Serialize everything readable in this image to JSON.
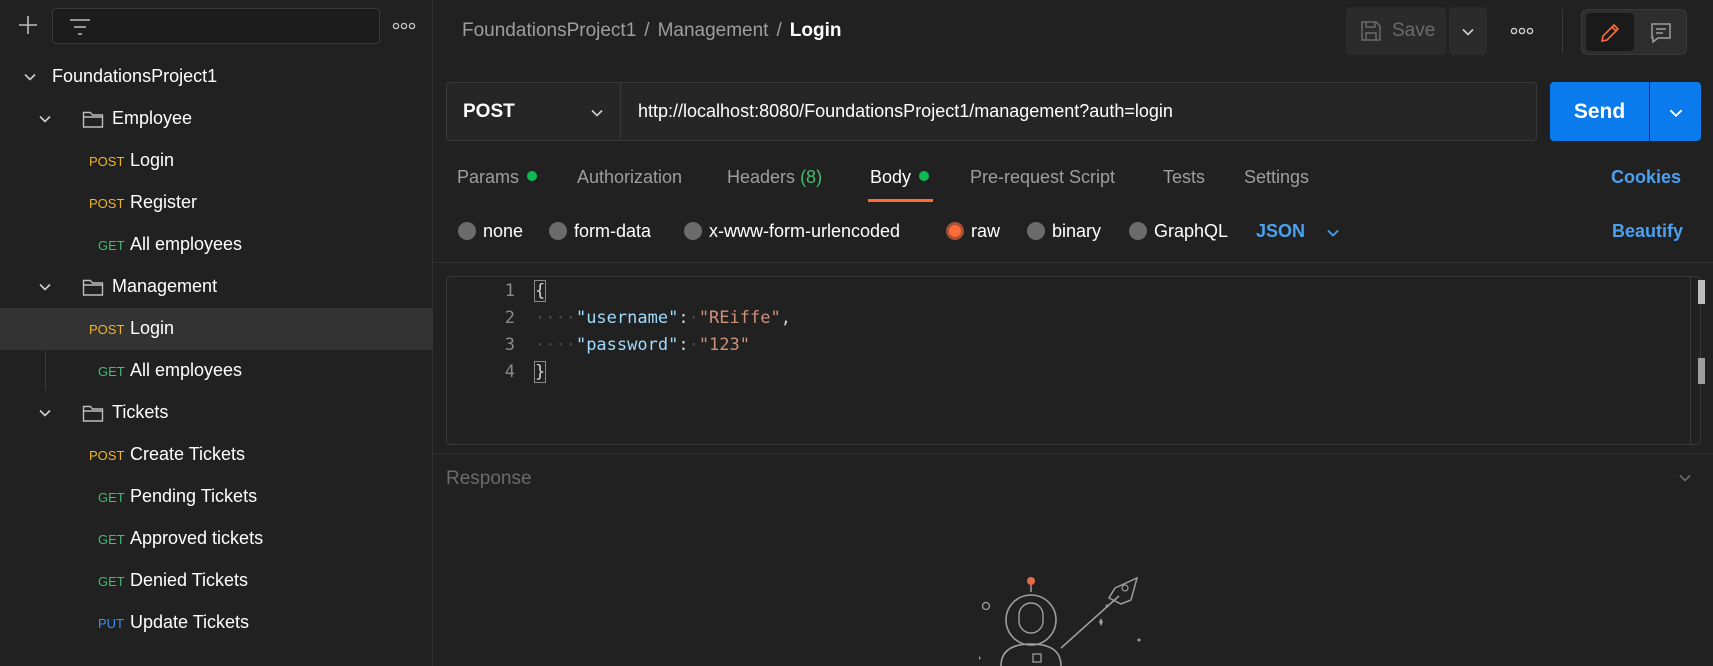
{
  "sidebar": {
    "tree": [
      {
        "kind": "collection",
        "label": "FoundationsProject1"
      },
      {
        "kind": "folder",
        "label": "Employee"
      },
      {
        "kind": "request",
        "method": "POST",
        "label": "Login"
      },
      {
        "kind": "request",
        "method": "POST",
        "label": "Register"
      },
      {
        "kind": "request",
        "method": "GET",
        "label": "All employees"
      },
      {
        "kind": "folder",
        "label": "Management"
      },
      {
        "kind": "request",
        "method": "POST",
        "label": "Login",
        "selected": true
      },
      {
        "kind": "request",
        "method": "GET",
        "label": "All employees"
      },
      {
        "kind": "folder",
        "label": "Tickets"
      },
      {
        "kind": "request",
        "method": "POST",
        "label": "Create Tickets"
      },
      {
        "kind": "request",
        "method": "GET",
        "label": "Pending Tickets"
      },
      {
        "kind": "request",
        "method": "GET",
        "label": "Approved tickets"
      },
      {
        "kind": "request",
        "method": "GET",
        "label": "Denied Tickets"
      },
      {
        "kind": "request",
        "method": "PUT",
        "label": "Update Tickets"
      }
    ]
  },
  "header": {
    "breadcrumb": [
      "FoundationsProject1",
      "Management",
      "Login"
    ],
    "save_label": "Save"
  },
  "request": {
    "method": "POST",
    "url": "http://localhost:8080/FoundationsProject1/management?auth=login",
    "send_label": "Send",
    "tabs": [
      {
        "label": "Params",
        "dot": true
      },
      {
        "label": "Authorization"
      },
      {
        "label": "Headers",
        "count": "(8)"
      },
      {
        "label": "Body",
        "dot": true,
        "active": true
      },
      {
        "label": "Pre-request Script"
      },
      {
        "label": "Tests"
      },
      {
        "label": "Settings"
      }
    ],
    "cookies_label": "Cookies",
    "body_types": [
      {
        "label": "none"
      },
      {
        "label": "form-data"
      },
      {
        "label": "x-www-form-urlencoded"
      },
      {
        "label": "raw",
        "selected": true
      },
      {
        "label": "binary"
      },
      {
        "label": "GraphQL"
      }
    ],
    "body_format": "JSON",
    "beautify_label": "Beautify",
    "body_lines": [
      {
        "num": "1",
        "open": "{"
      },
      {
        "num": "2",
        "indent": "····",
        "key": "\"username\"",
        "colon": ":",
        "space": "·",
        "value": "\"REiffe\"",
        "tail": ","
      },
      {
        "num": "3",
        "indent": "····",
        "key": "\"password\"",
        "colon": ":",
        "space": "·",
        "value": "\"123\"",
        "tail": ""
      },
      {
        "num": "4",
        "close": "}"
      }
    ]
  },
  "response": {
    "title": "Response"
  },
  "colors": {
    "accent": "#ff6c37",
    "send": "#097bed",
    "post": "#f0b428",
    "get": "#3ebd6f",
    "put": "#3d8ff6",
    "link": "#4aa1f2"
  }
}
